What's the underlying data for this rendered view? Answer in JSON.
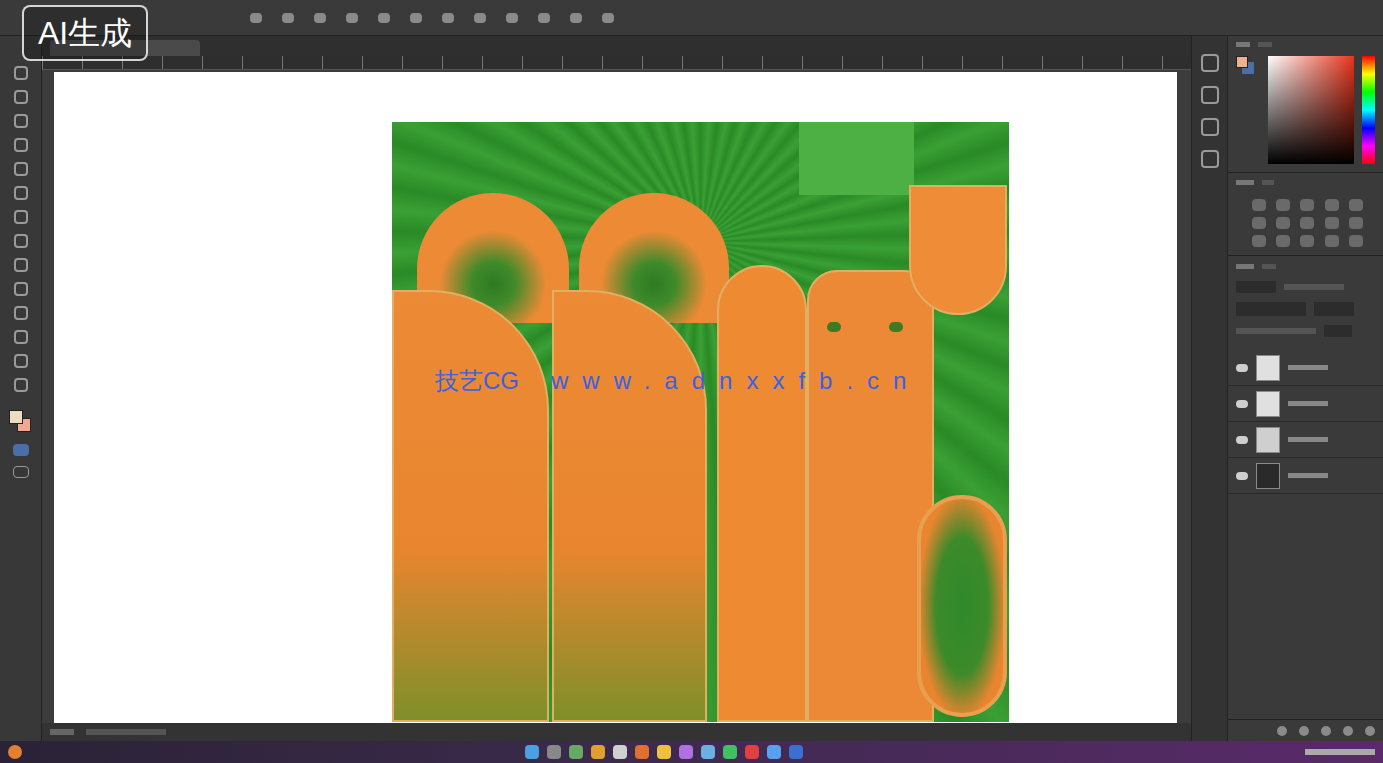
{
  "watermark": {
    "badge": "AI生成",
    "site_name": "技艺CG",
    "site_url": "www.adnxxfb.cn"
  },
  "layers": [
    {
      "visible": true
    },
    {
      "visible": true
    },
    {
      "visible": true
    },
    {
      "visible": true
    }
  ]
}
